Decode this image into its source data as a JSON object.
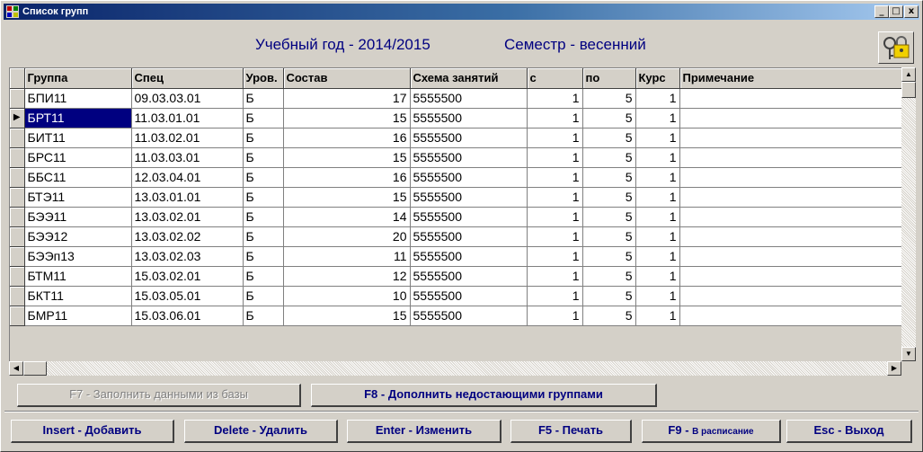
{
  "window": {
    "title": "Список групп",
    "controls": {
      "minimize": "_",
      "maximize": "□",
      "close": "x"
    }
  },
  "header": {
    "year": "Учебный год - 2014/2015",
    "semester": "Семестр - весенний"
  },
  "grid": {
    "columns": [
      "Группа",
      "Спец",
      "Уров.",
      "Состав",
      "Схема занятий",
      "с",
      "по",
      "Курс",
      "Примечание"
    ],
    "current_row": 1,
    "rows": [
      [
        "БПИ11",
        "09.03.03.01",
        "Б",
        "17",
        "5555500",
        "1",
        "5",
        "1",
        ""
      ],
      [
        "БРТ11",
        "11.03.01.01",
        "Б",
        "15",
        "5555500",
        "1",
        "5",
        "1",
        ""
      ],
      [
        "БИТ11",
        "11.03.02.01",
        "Б",
        "16",
        "5555500",
        "1",
        "5",
        "1",
        ""
      ],
      [
        "БРС11",
        "11.03.03.01",
        "Б",
        "15",
        "5555500",
        "1",
        "5",
        "1",
        ""
      ],
      [
        "ББС11",
        "12.03.04.01",
        "Б",
        "16",
        "5555500",
        "1",
        "5",
        "1",
        ""
      ],
      [
        "БТЭ11",
        "13.03.01.01",
        "Б",
        "15",
        "5555500",
        "1",
        "5",
        "1",
        ""
      ],
      [
        "БЭЭ11",
        "13.03.02.01",
        "Б",
        "14",
        "5555500",
        "1",
        "5",
        "1",
        ""
      ],
      [
        "БЭЭ12",
        "13.03.02.02",
        "Б",
        "20",
        "5555500",
        "1",
        "5",
        "1",
        ""
      ],
      [
        "БЭЭп13",
        "13.03.02.03",
        "Б",
        "11",
        "5555500",
        "1",
        "5",
        "1",
        ""
      ],
      [
        "БТМ11",
        "15.03.02.01",
        "Б",
        "12",
        "5555500",
        "1",
        "5",
        "1",
        ""
      ],
      [
        "БКТ11",
        "15.03.05.01",
        "Б",
        "10",
        "5555500",
        "1",
        "5",
        "1",
        ""
      ],
      [
        "БМР11",
        "15.03.06.01",
        "Б",
        "15",
        "5555500",
        "1",
        "5",
        "1",
        ""
      ]
    ]
  },
  "actions": {
    "f7": "F7 - Заполнить данными из базы",
    "f8": "F8 - Дополнить недостающими группами",
    "insert": "Insert - Добавить",
    "delete": "Delete - Удалить",
    "enter": "Enter - Изменить",
    "f5": "F5 - Печать",
    "f9_key": "F9 - ",
    "f9_text": "В расписание",
    "esc": "Esc - Выход"
  },
  "icons": {
    "app": "groups-app-icon",
    "lock": "keys-lock-icon"
  },
  "colors": {
    "title_bar_start": "#0a246a",
    "title_bar_end": "#a6caf0",
    "header_text": "#000080",
    "selection": "#000080"
  }
}
